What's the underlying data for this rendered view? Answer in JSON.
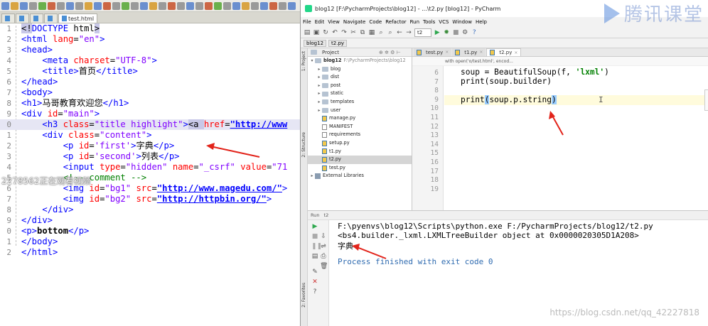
{
  "left_editor": {
    "tabs": [
      "",
      "",
      "",
      "",
      "test.html"
    ],
    "code_lines": [
      {
        "n": "1",
        "parts": [
          [
            "sel-tag",
            "<!"
          ],
          [
            "t-tag",
            "DOCTYPE"
          ],
          [
            "t-text",
            " html"
          ],
          [
            "sel-tag",
            ">"
          ]
        ]
      },
      {
        "n": "2",
        "parts": [
          [
            "t-tag",
            "<html "
          ],
          [
            "t-attr",
            "lang"
          ],
          [
            "t-text",
            "="
          ],
          [
            "t-val",
            "\"en\""
          ],
          [
            "t-tag",
            ">"
          ]
        ]
      },
      {
        "n": "3",
        "parts": [
          [
            "t-tag",
            "<head>"
          ]
        ]
      },
      {
        "n": "4",
        "parts": [
          [
            "t-text",
            "    "
          ],
          [
            "t-tag",
            "<meta "
          ],
          [
            "t-attr",
            "charset"
          ],
          [
            "t-text",
            "="
          ],
          [
            "t-val",
            "\"UTF-8\""
          ],
          [
            "t-tag",
            ">"
          ]
        ]
      },
      {
        "n": "5",
        "parts": [
          [
            "t-text",
            "    "
          ],
          [
            "t-tag",
            "<title>"
          ],
          [
            "t-text",
            "首页"
          ],
          [
            "t-tag",
            "</title>"
          ]
        ]
      },
      {
        "n": "6",
        "parts": [
          [
            "t-tag",
            "</head>"
          ]
        ]
      },
      {
        "n": "7",
        "parts": [
          [
            "t-tag",
            "<body>"
          ]
        ]
      },
      {
        "n": "8",
        "parts": [
          [
            "t-tag",
            "<h1>"
          ],
          [
            "t-text",
            "马哥教育欢迎您"
          ],
          [
            "t-tag",
            "</h1>"
          ]
        ]
      },
      {
        "n": "9",
        "parts": [
          [
            "t-tag",
            "<div "
          ],
          [
            "t-attr",
            "id"
          ],
          [
            "t-text",
            "="
          ],
          [
            "t-val",
            "\"main\""
          ],
          [
            "t-tag",
            ">"
          ]
        ]
      },
      {
        "n": "0",
        "hl": true,
        "parts": [
          [
            "t-text",
            "    "
          ],
          [
            "t-tag",
            "<h3 "
          ],
          [
            "t-attr",
            "class"
          ],
          [
            "t-text",
            "="
          ],
          [
            "t-val",
            "\"title highlight\""
          ],
          [
            "t-tag",
            ">"
          ],
          [
            "sel-tag",
            "<a "
          ],
          [
            "t-attr",
            "href"
          ],
          [
            "t-text",
            "="
          ],
          [
            "t-url",
            "\"http://www"
          ]
        ]
      },
      {
        "n": "1",
        "parts": [
          [
            "t-text",
            "    "
          ],
          [
            "t-tag",
            "<div "
          ],
          [
            "t-attr",
            "class"
          ],
          [
            "t-text",
            "="
          ],
          [
            "t-val",
            "\"content\""
          ],
          [
            "t-tag",
            ">"
          ]
        ]
      },
      {
        "n": "2",
        "parts": [
          [
            "t-text",
            "        "
          ],
          [
            "t-tag",
            "<p "
          ],
          [
            "t-attr",
            "id"
          ],
          [
            "t-text",
            "="
          ],
          [
            "t-val",
            "'first'"
          ],
          [
            "t-tag",
            ">"
          ],
          [
            "t-text",
            "字典"
          ],
          [
            "t-tag",
            "</p>"
          ]
        ]
      },
      {
        "n": "3",
        "parts": [
          [
            "t-text",
            "        "
          ],
          [
            "t-tag",
            "<p "
          ],
          [
            "t-attr",
            "id"
          ],
          [
            "t-text",
            "="
          ],
          [
            "t-val",
            "'second'"
          ],
          [
            "t-tag",
            ">"
          ],
          [
            "t-text",
            "列表"
          ],
          [
            "t-tag",
            "</p>"
          ]
        ]
      },
      {
        "n": "4",
        "parts": [
          [
            "t-text",
            "        "
          ],
          [
            "t-tag",
            "<input "
          ],
          [
            "t-attr",
            "type"
          ],
          [
            "t-text",
            "="
          ],
          [
            "t-val",
            "\"hidden\""
          ],
          [
            "t-text",
            " "
          ],
          [
            "t-attr",
            "name"
          ],
          [
            "t-text",
            "="
          ],
          [
            "t-val",
            "\"_csrf\""
          ],
          [
            "t-text",
            " "
          ],
          [
            "t-attr",
            "value"
          ],
          [
            "t-text",
            "="
          ],
          [
            "t-val",
            "\"71"
          ]
        ]
      },
      {
        "n": "5",
        "parts": [
          [
            "t-text",
            "        "
          ],
          [
            "t-comment",
            "<!-- comment -->"
          ]
        ]
      },
      {
        "n": "6",
        "parts": [
          [
            "t-text",
            "        "
          ],
          [
            "t-tag",
            "<img "
          ],
          [
            "t-attr",
            "id"
          ],
          [
            "t-text",
            "="
          ],
          [
            "t-val",
            "\"bg1\""
          ],
          [
            "t-text",
            " "
          ],
          [
            "t-attr",
            "src"
          ],
          [
            "t-text",
            "="
          ],
          [
            "t-url",
            "\"http://www.magedu.com/\""
          ],
          [
            "t-tag",
            ">"
          ]
        ]
      },
      {
        "n": "7",
        "parts": [
          [
            "t-text",
            "        "
          ],
          [
            "t-tag",
            "<img "
          ],
          [
            "t-attr",
            "id"
          ],
          [
            "t-text",
            "="
          ],
          [
            "t-val",
            "\"bg2\""
          ],
          [
            "t-text",
            " "
          ],
          [
            "t-attr",
            "src"
          ],
          [
            "t-text",
            "="
          ],
          [
            "t-url",
            "\"http://httpbin.org/\""
          ],
          [
            "t-tag",
            ">"
          ]
        ]
      },
      {
        "n": "8",
        "parts": [
          [
            "t-text",
            "    "
          ],
          [
            "t-tag",
            "</div>"
          ]
        ]
      },
      {
        "n": "9",
        "parts": [
          [
            "t-tag",
            "</div>"
          ]
        ]
      },
      {
        "n": "0",
        "parts": [
          [
            "t-tag",
            "<p>"
          ],
          [
            "t-bold",
            "bottom"
          ],
          [
            "t-tag",
            "</p>"
          ]
        ]
      },
      {
        "n": "1",
        "parts": [
          [
            "t-tag",
            "</body>"
          ]
        ]
      },
      {
        "n": "2",
        "parts": [
          [
            "t-tag",
            "</html>"
          ]
        ]
      }
    ],
    "watermark": "2278562正在观看视频"
  },
  "pycharm": {
    "title": "blog12 [F:\\PycharmProjects\\blog12] - ...\\t2.py [blog12] - PyCharm",
    "menu": [
      "File",
      "Edit",
      "View",
      "Navigate",
      "Code",
      "Refactor",
      "Run",
      "Tools",
      "VCS",
      "Window",
      "Help"
    ],
    "run_config": "t2",
    "nav_crumbs": [
      "blog12",
      "t2.py"
    ],
    "project_header": "Project",
    "tree": [
      {
        "label": "blog12",
        "path": "F:\\PycharmProjects\\blog12",
        "kind": "root",
        "depth": 0,
        "arrow": "▾"
      },
      {
        "label": "blog",
        "kind": "folder",
        "depth": 1,
        "arrow": "▸"
      },
      {
        "label": "dist",
        "kind": "folder",
        "depth": 1,
        "arrow": "▸"
      },
      {
        "label": "post",
        "kind": "folder",
        "depth": 1,
        "arrow": "▸"
      },
      {
        "label": "static",
        "kind": "folder",
        "depth": 1,
        "arrow": "▸"
      },
      {
        "label": "templates",
        "kind": "folder",
        "depth": 1,
        "arrow": "▸"
      },
      {
        "label": "user",
        "kind": "folder",
        "depth": 1,
        "arrow": "▸"
      },
      {
        "label": "manage.py",
        "kind": "py",
        "depth": 1
      },
      {
        "label": "MANIFEST",
        "kind": "txt",
        "depth": 1
      },
      {
        "label": "requirements",
        "kind": "txt",
        "depth": 1
      },
      {
        "label": "setup.py",
        "kind": "py",
        "depth": 1
      },
      {
        "label": "t1.py",
        "kind": "py",
        "depth": 1
      },
      {
        "label": "t2.py",
        "kind": "py",
        "depth": 1,
        "selected": true
      },
      {
        "label": "test.py",
        "kind": "py",
        "depth": 1
      },
      {
        "label": "External Libraries",
        "kind": "lib",
        "depth": 0,
        "arrow": "▸"
      }
    ],
    "editor_tabs": [
      {
        "label": "test.py",
        "active": false
      },
      {
        "label": "t1.py",
        "active": false
      },
      {
        "label": "t2.py",
        "active": true
      }
    ],
    "editor_breadcrumb": "with open('o/test.html', encod...",
    "line_numbers": [
      "6",
      "7",
      "8",
      "9",
      "10",
      "11",
      "12",
      "13",
      "14",
      "15",
      "16",
      "17",
      "18",
      "19"
    ],
    "code": {
      "l6_pre": "soup = BeautifulSoup(f, ",
      "l6_str": "'lxml'",
      "l6_post": ")",
      "l7": "print(soup.builder)",
      "l9_pre": "print",
      "l9_open": "(",
      "l9_mid": "soup.p.string",
      "l9_close": ")"
    },
    "run_header": "Run",
    "run_config_tab": "t2",
    "output": [
      "F:\\pyenvs\\blog12\\Scripts\\python.exe F:/PycharmProjects/blog12/t2.py",
      "<bs4.builder._lxml.LXMLTreeBuilder object at 0x0000020305D1A208>",
      "字典",
      "",
      "Process finished with exit code 0"
    ],
    "side_tabs": [
      "1: Project",
      "2: Structure",
      "2: Favorites"
    ]
  },
  "watermark_br": "https://blog.csdn.net/qq_42227818",
  "logo_text": "腾讯课堂"
}
